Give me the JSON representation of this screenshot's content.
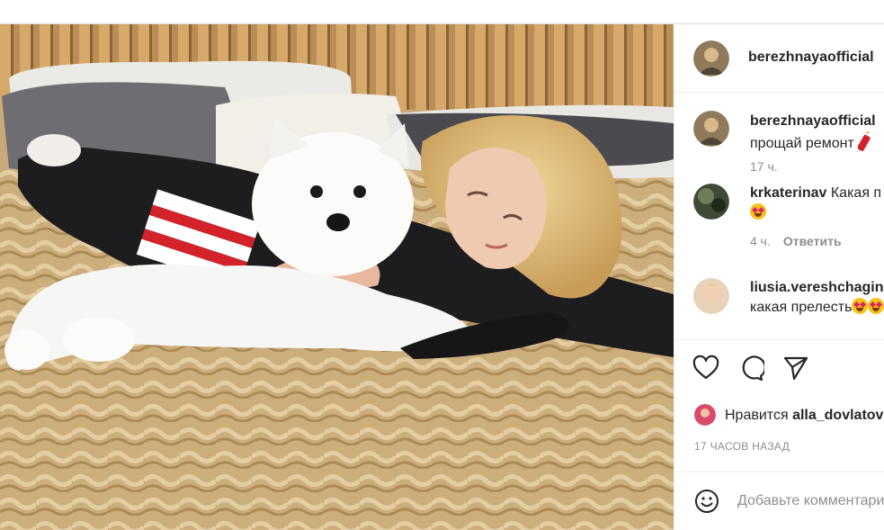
{
  "post": {
    "author": "berezhnayaofficial",
    "image_description": "Blonde woman lying on a bed with a fluffy white samoyed puppy"
  },
  "comments": [
    {
      "user": "berezhnayaofficial",
      "text": "прощай ремонт",
      "emoji": "firecracker",
      "time": "17 ч.",
      "reply": ""
    },
    {
      "user": "krkaterinav",
      "text": "Какая п",
      "emoji": "star-struck",
      "time": "4 ч.",
      "reply": "Ответить"
    },
    {
      "user": "liusia.vereshchagina",
      "text": "какая прелесть",
      "emoji": "star-struck",
      "time": "",
      "reply": ""
    }
  ],
  "actions": {
    "like_icon": "heart-icon",
    "comment_icon": "comment-icon",
    "share_icon": "send-icon"
  },
  "likes": {
    "prefix": "Нравится",
    "user": "alla_dovlatov"
  },
  "timestamp": "17 ЧАСОВ НАЗАД",
  "add_comment": {
    "placeholder": "Добавьте комментарий..."
  },
  "colors": {
    "text": "#262626",
    "muted": "#8e8e8e",
    "divider": "#efefef"
  }
}
